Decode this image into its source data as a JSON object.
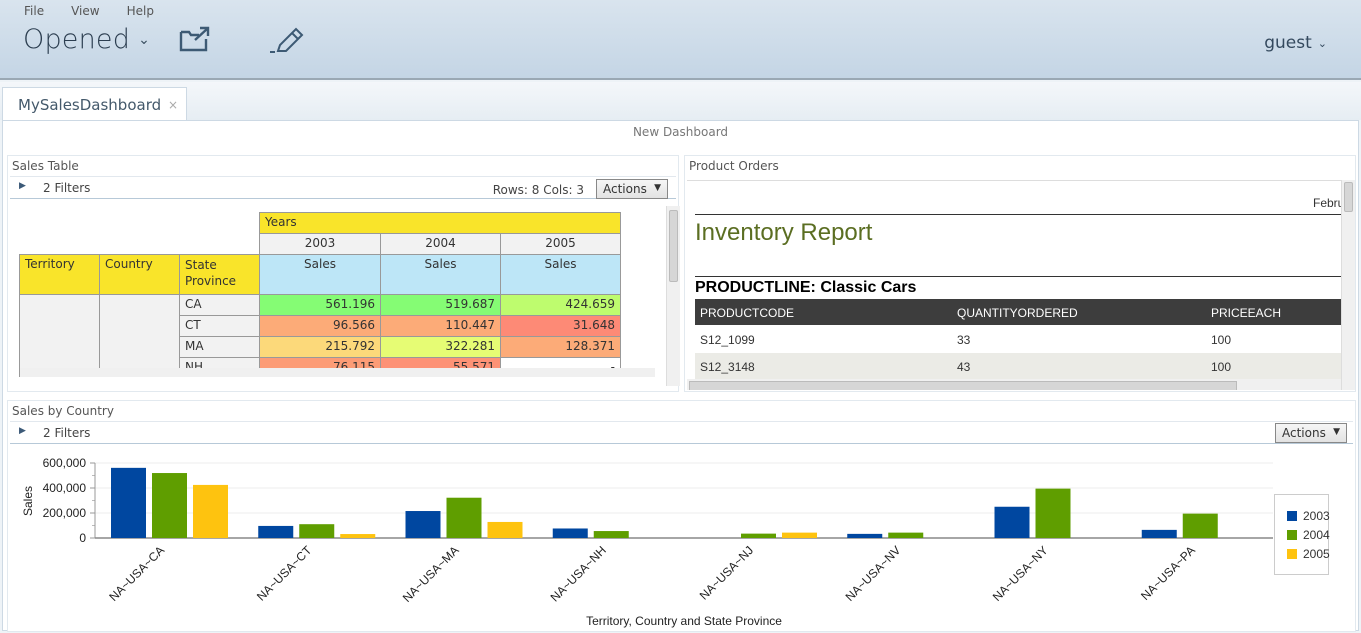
{
  "menu": [
    "File",
    "View",
    "Help"
  ],
  "header": {
    "title": "Opened",
    "user": "guest",
    "icons": [
      "open-folder-icon",
      "edit-pencil-icon"
    ]
  },
  "tabs": [
    {
      "label": "MySalesDashboard",
      "close": "×"
    }
  ],
  "dashboard": {
    "title": "New Dashboard"
  },
  "sales_table": {
    "title": "Sales Table",
    "filters": "2 Filters",
    "rows_cols": "Rows: 8  Cols: 3",
    "actions": "Actions",
    "col_group": "Years",
    "years": [
      "2003",
      "2004",
      "2005"
    ],
    "row_headers": [
      "Territory",
      "Country",
      "State Province"
    ],
    "measure": "Sales",
    "rows": [
      {
        "state": "CA",
        "values": [
          "561.196",
          "519.687",
          "424.659"
        ],
        "colors": [
          "#85fc74",
          "#85fc74",
          "#befc6e"
        ]
      },
      {
        "state": "CT",
        "values": [
          "96.566",
          "110.447",
          "31.648"
        ],
        "colors": [
          "#fcab78",
          "#fcab78",
          "#fd8a76"
        ]
      },
      {
        "state": "MA",
        "values": [
          "215.792",
          "322.281",
          "128.371"
        ],
        "colors": [
          "#fcd97a",
          "#e6fc74",
          "#fcab78"
        ]
      },
      {
        "state": "NH",
        "values": [
          "76.115",
          "55.571",
          "-"
        ],
        "colors": [
          "#fc9c76",
          "#fd9276",
          "#ffffff"
        ]
      }
    ]
  },
  "product_orders": {
    "title": "Product Orders",
    "date_partial": "Febru",
    "report_title": "Inventory Report",
    "productline": "PRODUCTLINE: Classic Cars",
    "columns": [
      "PRODUCTCODE",
      "QUANTITYORDERED",
      "PRICEEACH"
    ],
    "rows": [
      [
        "S12_1099",
        "33",
        "100"
      ],
      [
        "S12_3148",
        "43",
        "100"
      ]
    ]
  },
  "sales_by_country": {
    "title": "Sales by Country",
    "filters": "2 Filters",
    "actions": "Actions"
  },
  "chart_data": {
    "type": "bar",
    "title": "Sales by Country",
    "xlabel": "Territory, Country and State Province",
    "ylabel": "Sales",
    "ylim": [
      0,
      600000
    ],
    "yticks": [
      "0",
      "200,000",
      "400,000",
      "600,000"
    ],
    "ytick_values": [
      0,
      200000,
      400000,
      600000
    ],
    "grid": true,
    "legend": "right",
    "categories": [
      "NA~USA~CA",
      "NA~USA~CT",
      "NA~USA~MA",
      "NA~USA~NH",
      "NA~USA~NJ",
      "NA~USA~NV",
      "NA~USA~NY",
      "NA~USA~PA"
    ],
    "series": [
      {
        "name": "2003",
        "color": "#0047a0",
        "values": [
          561196,
          96566,
          215792,
          76115,
          null,
          33000,
          250000,
          65000
        ]
      },
      {
        "name": "2004",
        "color": "#5f9e00",
        "values": [
          519687,
          110447,
          322281,
          55571,
          35000,
          43000,
          395000,
          195000
        ]
      },
      {
        "name": "2005",
        "color": "#fec30f",
        "values": [
          424659,
          31648,
          128371,
          null,
          43000,
          null,
          null,
          null
        ]
      }
    ]
  }
}
